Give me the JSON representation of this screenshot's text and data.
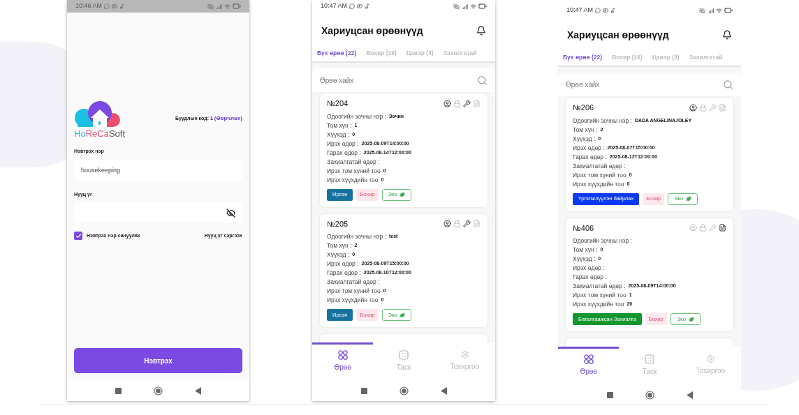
{
  "login": {
    "status_time": "10:46 AM",
    "logo": [
      {
        "text": "Ho",
        "color": "#1cc0e4"
      },
      {
        "text": "Re",
        "color": "#ef4f6f"
      },
      {
        "text": "Ca",
        "color": "#ef4f6f"
      },
      {
        "text": "Soft",
        "color": "#555555"
      }
    ],
    "branch_label": "Буудлын код: 1",
    "branch_link": "(Өөрчлөх)",
    "username": {
      "label": "Нэвтрэх нэр",
      "value": "housekeeping"
    },
    "password": {
      "label": "Нууц үг"
    },
    "remember": {
      "label": "Нэвтрэх нэр сануулах",
      "checked": true
    },
    "forgot": "Нууц үг сэргээх",
    "submit": "Нэвтрэх"
  },
  "room_screens": [
    {
      "status_time": "10:47 AM",
      "title": "Хариуцсан өрөөнүүд",
      "tabs": [
        {
          "label": "Бүх өрөө (22)",
          "selected": true
        },
        {
          "label": "Бохир (19)",
          "selected": false
        },
        {
          "label": "Цэвэр (3)",
          "selected": false
        },
        {
          "label": "Захилгатай",
          "selected": false
        }
      ],
      "search": {
        "placeholder": "Өрөө хайх"
      },
      "rooms": [
        {
          "number": "№204",
          "icons": [
            {
              "kind": "guest",
              "active": true
            },
            {
              "kind": "lock",
              "active": false
            },
            {
              "kind": "repair",
              "active": true
            },
            {
              "kind": "note",
              "active": false
            }
          ],
          "fields": [
            {
              "label": "Одоогийн зочны нэр :",
              "value": "Зочин"
            },
            {
              "label": "Том хүн :",
              "value": "1"
            },
            {
              "label": "Хүүхэд :",
              "value": "0"
            },
            {
              "label": "Ирэх өдөр :",
              "value": "2025-08-09T14:00:00"
            },
            {
              "label": "Гарах өдөр :",
              "value": "2025-08-14T12:00:00"
            },
            {
              "label": "Захиалгатай өдөр :"
            },
            {
              "label": "Ирэх том хүний тоо",
              "value": "0"
            },
            {
              "label": "Ирэх хүүхдийн тоо",
              "value": "0"
            }
          ],
          "badges": [
            {
              "kind": "status",
              "text": "Ирсэн",
              "color": "#17729f"
            },
            {
              "kind": "dirty",
              "text": "Бохир"
            },
            {
              "kind": "eco",
              "text": "Эко"
            }
          ]
        },
        {
          "number": "№205",
          "icons": [
            {
              "kind": "guest",
              "active": true
            },
            {
              "kind": "lock",
              "active": false
            },
            {
              "kind": "repair",
              "active": true
            },
            {
              "kind": "note",
              "active": false
            }
          ],
          "fields": [
            {
              "label": "Одоогийн зочны нэр :",
              "value": "test"
            },
            {
              "label": "Том хүн :",
              "value": "2"
            },
            {
              "label": "Хүүхэд :",
              "value": "0"
            },
            {
              "label": "Ирэх өдөр :",
              "value": "2025-08-09T15:00:00"
            },
            {
              "label": "Гарах өдөр :",
              "value": "2025-08-10T12:00:00"
            },
            {
              "label": "Захиалгатай өдөр :"
            },
            {
              "label": "Ирэх том хүний тоо",
              "value": "0"
            },
            {
              "label": "Ирэх хүүхдийн тоо",
              "value": "0"
            }
          ],
          "badges": [
            {
              "kind": "status",
              "text": "Ирсэн",
              "color": "#17729f"
            },
            {
              "kind": "dirty",
              "text": "Бохир"
            },
            {
              "kind": "eco",
              "text": "Эко"
            }
          ]
        }
      ],
      "nav": [
        {
          "kind": "rooms",
          "label": "Өрөө",
          "selected": true
        },
        {
          "kind": "tasks",
          "label": "Таск",
          "selected": false
        },
        {
          "kind": "settings",
          "label": "Тохиргоо",
          "selected": false
        }
      ]
    },
    {
      "status_time": "10:47 AM",
      "title": "Хариуцсан өрөөнүүд",
      "tabs": [
        {
          "label": "Бүх өрөө (22)",
          "selected": true
        },
        {
          "label": "Бохир (19)",
          "selected": false
        },
        {
          "label": "Цэвэр (3)",
          "selected": false
        },
        {
          "label": "Захилгатай",
          "selected": false
        }
      ],
      "search": {
        "placeholder": "Өрөө хайх"
      },
      "rooms": [
        {
          "number": "№206",
          "icons": [
            {
              "kind": "guest",
              "active": true
            },
            {
              "kind": "lock",
              "active": false
            },
            {
              "kind": "repair",
              "active": false
            },
            {
              "kind": "note",
              "active": false
            }
          ],
          "fields": [
            {
              "label": "Одоогийн зочны нэр :",
              "value": "DADA ANGELINAJOLEY"
            },
            {
              "label": "Том хүн :",
              "value": "2"
            },
            {
              "label": "Хүүхэд :",
              "value": "0"
            },
            {
              "label": "Ирэх өдөр :",
              "value": "2025-08-07T15:00:00"
            },
            {
              "label": "Гарах өдөр :",
              "value": "2025-08-12T12:00:00"
            },
            {
              "label": "Захиалгатай өдөр :"
            },
            {
              "label": "Ирэх том хүний тоо",
              "value": "0"
            },
            {
              "label": "Ирэх хүүхдийн тоо",
              "value": "0"
            }
          ],
          "badges": [
            {
              "kind": "status",
              "text": "Үргэлжлүүлэн байрлах",
              "color": "#0a3af0"
            },
            {
              "kind": "dirty",
              "text": "Бохир"
            },
            {
              "kind": "eco",
              "text": "Эко"
            }
          ]
        },
        {
          "number": "№406",
          "icons": [
            {
              "kind": "guest",
              "active": false
            },
            {
              "kind": "lock",
              "active": false
            },
            {
              "kind": "repair",
              "active": false
            },
            {
              "kind": "note",
              "active": true
            }
          ],
          "fields": [
            {
              "label": "Одоогийн зочны нэр :"
            },
            {
              "label": "Том хүн :",
              "value": "0"
            },
            {
              "label": "Хүүхэд :",
              "value": "0"
            },
            {
              "label": "Ирэх өдөр :"
            },
            {
              "label": "Гарах өдөр :"
            },
            {
              "label": "Захиалгатай өдөр :",
              "value": "2025-08-09T14:00:00"
            },
            {
              "label": "Ирэх том хүний тоо",
              "value": "1"
            },
            {
              "label": "Ирэх хүүхдийн тоо",
              "value": "20"
            }
          ],
          "badges": [
            {
              "kind": "status",
              "text": "Баталгаажсан Захиалга",
              "color": "#12962f"
            },
            {
              "kind": "dirty",
              "text": "Бохир"
            },
            {
              "kind": "eco",
              "text": "Эко"
            }
          ]
        }
      ],
      "nav": [
        {
          "kind": "rooms",
          "label": "Өрөө",
          "selected": true
        },
        {
          "kind": "tasks",
          "label": "Таск",
          "selected": false
        },
        {
          "kind": "settings",
          "label": "Тохиргоо",
          "selected": false
        }
      ]
    }
  ]
}
